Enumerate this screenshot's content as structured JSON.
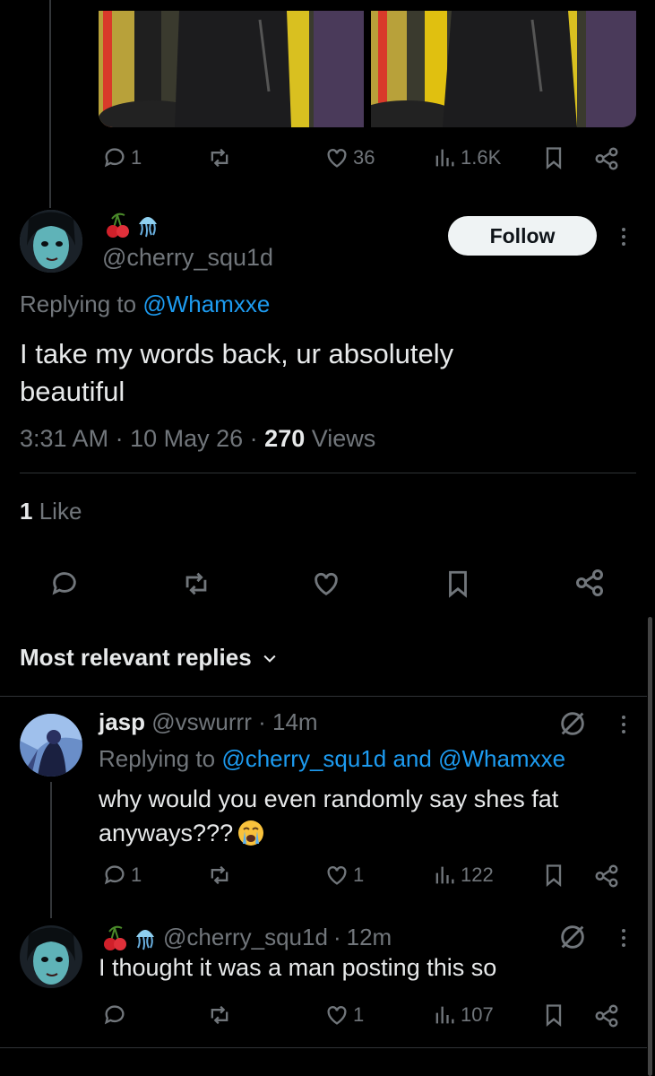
{
  "top_post": {
    "actions": {
      "replies": "1",
      "reposts": "",
      "likes": "36",
      "views": "1.6K"
    }
  },
  "main_reply": {
    "handle": "@cherry_squ1d",
    "follow_label": "Follow",
    "replying_prefix": "Replying to",
    "replying_to": "@Whamxxe",
    "text_line1": "I take my words back, ur absolutely",
    "text_line2": "beautiful",
    "time": "3:31 AM",
    "date": "10 May 26",
    "views_count": "270",
    "views_label": "Views",
    "likes_count": "1",
    "likes_label": "Like"
  },
  "sort": {
    "label": "Most relevant replies"
  },
  "replies": [
    {
      "name": "jasp",
      "handle": "@vswurrr",
      "time": "14m",
      "replying_prefix": "Replying to",
      "replying_to": "@cherry_squ1d and @Whamxxe",
      "text_line1": "why would you even randomly say shes fat",
      "text_line2": "anyways???",
      "reply_count": "1",
      "like_count": "1",
      "view_count": "122"
    },
    {
      "handle": "@cherry_squ1d",
      "time": "12m",
      "text_line1": "I thought it was a man posting this so",
      "reply_count": "",
      "like_count": "1",
      "view_count": "107"
    }
  ],
  "colors": {
    "accent": "#1d9bf0",
    "muted": "#71767b",
    "bg": "#000000"
  }
}
